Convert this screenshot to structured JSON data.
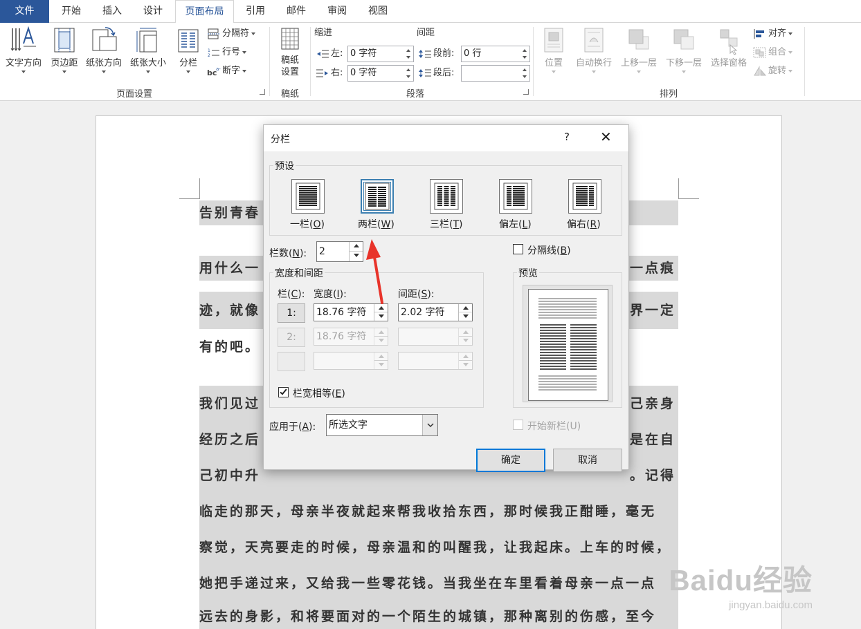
{
  "ribbon": {
    "tabs": [
      "文件",
      "开始",
      "插入",
      "设计",
      "页面布局",
      "引用",
      "邮件",
      "审阅",
      "视图"
    ],
    "active_tab": "页面布局",
    "page_setup": {
      "text_direction": "文字方向",
      "margins": "页边距",
      "orientation": "纸张方向",
      "size": "纸张大小",
      "columns": "分栏",
      "breaks": "分隔符",
      "line_numbers": "行号",
      "hyphenation": "断字",
      "group_label": "页面设置"
    },
    "manuscript": {
      "settings_line1": "稿纸",
      "settings_line2": "设置",
      "group_label": "稿纸"
    },
    "paragraph": {
      "indent_heading": "缩进",
      "spacing_heading": "间距",
      "left_label": "左:",
      "left_value": "0 字符",
      "right_label": "右:",
      "right_value": "0 字符",
      "before_label": "段前:",
      "before_value": "0 行",
      "after_label": "段后:",
      "after_value": "",
      "group_label": "段落"
    },
    "arrange": {
      "position": "位置",
      "wrap_text": "自动换行",
      "bring_forward": "上移一层",
      "send_backward": "下移一层",
      "selection_pane": "选择窗格",
      "align": "对齐",
      "group": "组合",
      "rotate": "旋转",
      "group_label": "排列"
    }
  },
  "document": {
    "lines": [
      "告别青春",
      "用什么一",
      "一点痕",
      "迹，就像",
      "界一定",
      "有的吧。",
      "我们见过",
      "己亲身",
      "经历之后",
      "是在自",
      "己初中升",
      "。记得",
      "临走的那天，母亲半夜就起来帮我收拾东西，那时候我正酣睡，毫无",
      "察觉，天亮要走的时候，母亲温和的叫醒我，让我起床。上车的时候，",
      "她把手递过来，又给我一些零花钱。当我坐在车里看着母亲一点一点",
      "远去的身影，和将要面对的一个陌生的城镇，那种离别的伤感，至今"
    ],
    "watermark_brand": "Baidu经验",
    "watermark_url": "jingyan.baidu.com"
  },
  "dialog": {
    "title": "分栏",
    "help": "?",
    "close": "✕",
    "presets_legend": "预设",
    "presets": [
      {
        "name": "一栏",
        "key": "O"
      },
      {
        "name": "两栏",
        "key": "W"
      },
      {
        "name": "三栏",
        "key": "T"
      },
      {
        "name": "偏左",
        "key": "L"
      },
      {
        "name": "偏右",
        "key": "R"
      }
    ],
    "selected_preset": "两栏",
    "num_columns_label": "栏数",
    "num_columns_key": "N",
    "num_columns_value": "2",
    "line_between_label": "分隔线",
    "line_between_key": "B",
    "width_spacing_legend": "宽度和间距",
    "col_header": "栏",
    "col_header_key": "C",
    "width_header": "宽度",
    "width_header_key": "I",
    "spacing_header": "间距",
    "spacing_header_key": "S",
    "rows": [
      {
        "col": "1:",
        "width": "18.76 字符",
        "spacing": "2.02 字符"
      },
      {
        "col": "2:",
        "width": "18.76 字符",
        "spacing": ""
      },
      {
        "col": "",
        "width": "",
        "spacing": ""
      }
    ],
    "equal_width_label": "栏宽相等",
    "equal_width_key": "E",
    "equal_width_checked": true,
    "preview_legend": "预览",
    "apply_to_label": "应用于",
    "apply_to_key": "A",
    "apply_to_value": "所选文字",
    "new_column_label": "开始新栏(U)",
    "ok": "确定",
    "cancel": "取消"
  },
  "colors": {
    "file_tab": "#2b579a",
    "selection_highlight": "#d9d9d9",
    "dialog_focus": "#0078d7",
    "annotation_arrow": "#e8332a"
  }
}
